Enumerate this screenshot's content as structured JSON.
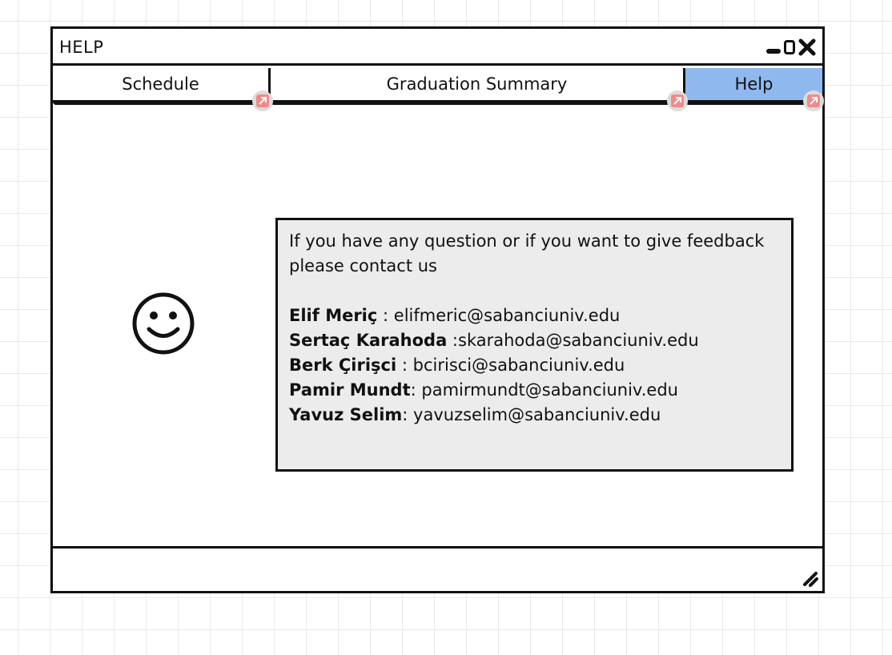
{
  "window": {
    "title": "HELP",
    "controls": {
      "minimize_icon": "minimize-icon",
      "maximize_icon": "maximize-icon",
      "close_icon": "close-icon"
    }
  },
  "tabs": [
    {
      "label": "Schedule",
      "active": false
    },
    {
      "label": "Graduation Summary",
      "active": false
    },
    {
      "label": "Help",
      "active": true
    }
  ],
  "main": {
    "icon": "smiley-face-icon",
    "intro": "If you have any question or if you want to give feedback please contact us",
    "contacts": [
      {
        "name": "Elif Meriç",
        "separator": " : ",
        "email": "elifmeric@sabanciuniv.edu"
      },
      {
        "name": "Sertaç Karahoda",
        "separator": " :",
        "email": "skarahoda@sabanciuniv.edu"
      },
      {
        "name": "Berk Çirişci",
        "separator": " : ",
        "email": "bcirisci@sabanciuniv.edu"
      },
      {
        "name": "Pamir Mundt",
        "separator": ": ",
        "email": "pamirmundt@sabanciuniv.edu"
      },
      {
        "name": "Yavuz Selim",
        "separator": ": ",
        "email": "yavuzselim@sabanciuniv.edu"
      }
    ]
  },
  "colors": {
    "active_tab": "#8fb8ee",
    "panel_background": "#ececec",
    "link_marker": "#f08a8a",
    "border": "#111111"
  }
}
